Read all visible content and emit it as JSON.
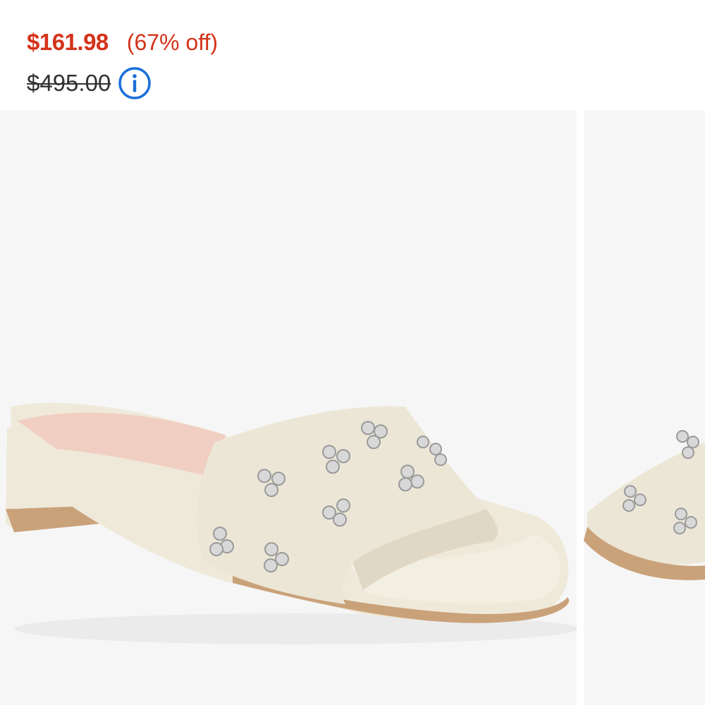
{
  "pricing": {
    "sale_price": "$161.98",
    "discount": "(67% off)",
    "original_price": "$495.00",
    "info_icon": "info-circle-icon"
  },
  "gallery": {
    "images": [
      {
        "subject": "cream leather slide sandal with crystal clusters",
        "position": "current"
      },
      {
        "subject": "cream leather slide sandal with crystal clusters",
        "position": "next"
      }
    ]
  },
  "colors": {
    "sale_red": "#d4331a",
    "discount_red": "#d4331a",
    "info_blue": "#1a6fd9",
    "image_bg": "#f6f6f6",
    "sandal_cream": "#ece6d6",
    "footbed_pink": "#f0cfc2",
    "sole_tan": "#caa27a"
  }
}
